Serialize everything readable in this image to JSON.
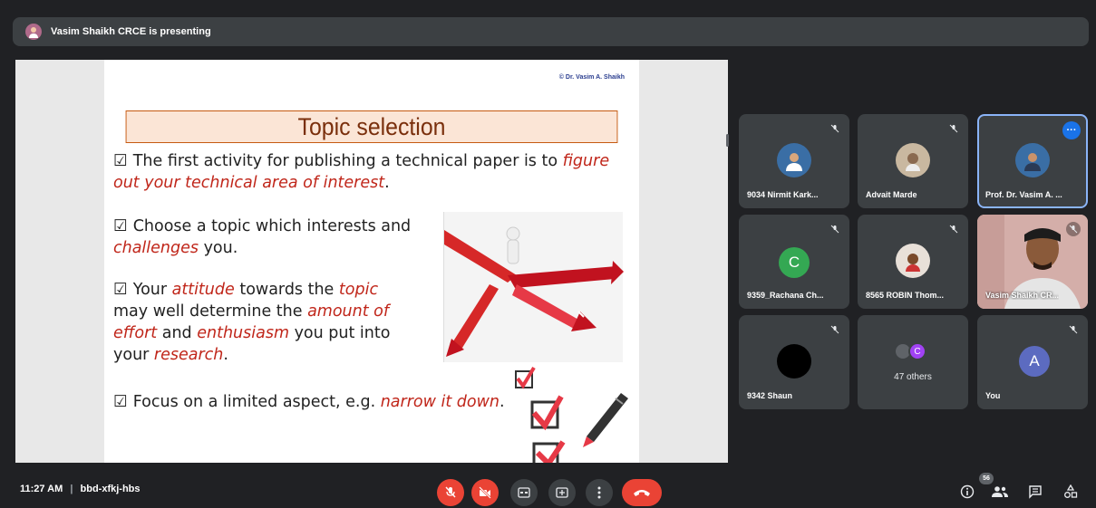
{
  "meeting": {
    "presenting_text": "Vasim Shaikh CRCE is presenting",
    "time": "11:27 AM",
    "code": "bbd-xfkj-hbs",
    "participant_count": "56"
  },
  "slide": {
    "copyright": "© Dr. Vasim A. Shaikh",
    "title": "Topic selection",
    "bullets": [
      {
        "checkbox": "☑",
        "a": "The first activity for publishing a technical paper is to ",
        "b": "figure out your technical area of interest",
        "c": "."
      },
      {
        "checkbox": "☑",
        "a": "Choose a topic which interests and",
        "b": "challenges",
        "c": " you."
      },
      {
        "checkbox": "☑",
        "a": "Your ",
        "b": "attitude",
        "c": " towards the ",
        "d": "topic",
        "e": "may well determine the ",
        "f": "amount of",
        "g": "effort",
        "h": " and ",
        "i": "enthusiasm",
        "j": " you put into",
        "k": "your ",
        "l": "research",
        "m": "."
      },
      {
        "checkbox": "☑",
        "a": "Focus on a limited aspect, e.g. ",
        "b": "narrow it down",
        "c": "."
      }
    ]
  },
  "participants": [
    {
      "name": "9034 Nirmit Kark...",
      "avatar": "photo",
      "muted": true
    },
    {
      "name": "Advait Marde",
      "avatar": "photo",
      "muted": true
    },
    {
      "name": "Prof. Dr. Vasim A. ...",
      "avatar": "photo",
      "muted": false,
      "active": true
    },
    {
      "name": "9359_Rachana Ch...",
      "avatar_letter": "C",
      "avatar_color": "#34a853",
      "muted": true
    },
    {
      "name": "8565 ROBIN Thom...",
      "avatar": "photo",
      "muted": true
    },
    {
      "name": "Vasim Shaikh CR...",
      "avatar": "video",
      "muted": true
    },
    {
      "name": "9342 Shaun",
      "avatar_color": "#000000",
      "muted": true
    },
    {
      "name": "47 others",
      "avatar_letter": "C",
      "avatar_color": "#a142f4"
    },
    {
      "name": "You",
      "avatar_letter": "A",
      "avatar_color": "#5c6bc0",
      "muted": true
    }
  ],
  "colors": {
    "accent_red": "#ea4335",
    "active_blue": "#1a73e8",
    "tile_bg": "#3c4043",
    "bg": "#202124"
  },
  "controls": [
    "mic-off-icon",
    "camera-off-icon",
    "captions-icon",
    "present-icon",
    "more-options-icon",
    "hang-up-icon"
  ],
  "right_icons": [
    "info-icon",
    "people-icon",
    "chat-icon",
    "activities-icon"
  ]
}
